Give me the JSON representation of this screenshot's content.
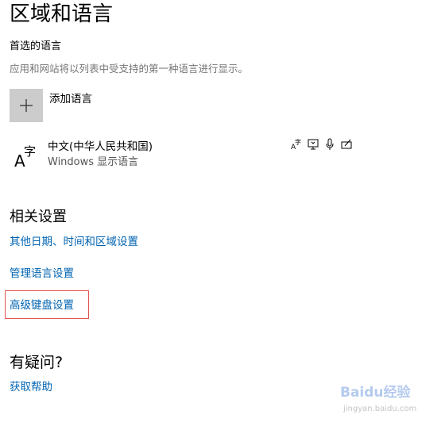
{
  "page": {
    "title": "区域和语言"
  },
  "preferred_languages": {
    "heading": "首选的语言",
    "description": "应用和网站将以列表中受支持的第一种语言进行显示。",
    "add_label": "添加语言",
    "add_icon": "plus-icon"
  },
  "language_list": [
    {
      "name": "中文(中华人民共和国)",
      "subtitle": "Windows 显示语言",
      "icon": "language-icon",
      "features": [
        "display-language-icon",
        "text-to-speech-icon",
        "speech-recognition-icon",
        "handwriting-icon"
      ]
    }
  ],
  "related_settings": {
    "heading": "相关设置",
    "links": {
      "date_time_region": "其他日期、时间和区域设置",
      "manage_language": "管理语言设置",
      "advanced_keyboard": "高级键盘设置"
    },
    "highlight_color": "#e0534f"
  },
  "questions": {
    "heading": "有疑问?",
    "help_link": "获取帮助"
  },
  "watermark": {
    "text": "Baidu经验",
    "url": "jingyan.baidu.com"
  },
  "colors": {
    "link": "#0063b1",
    "description": "#767676",
    "add_button_bg": "#cccccc"
  }
}
